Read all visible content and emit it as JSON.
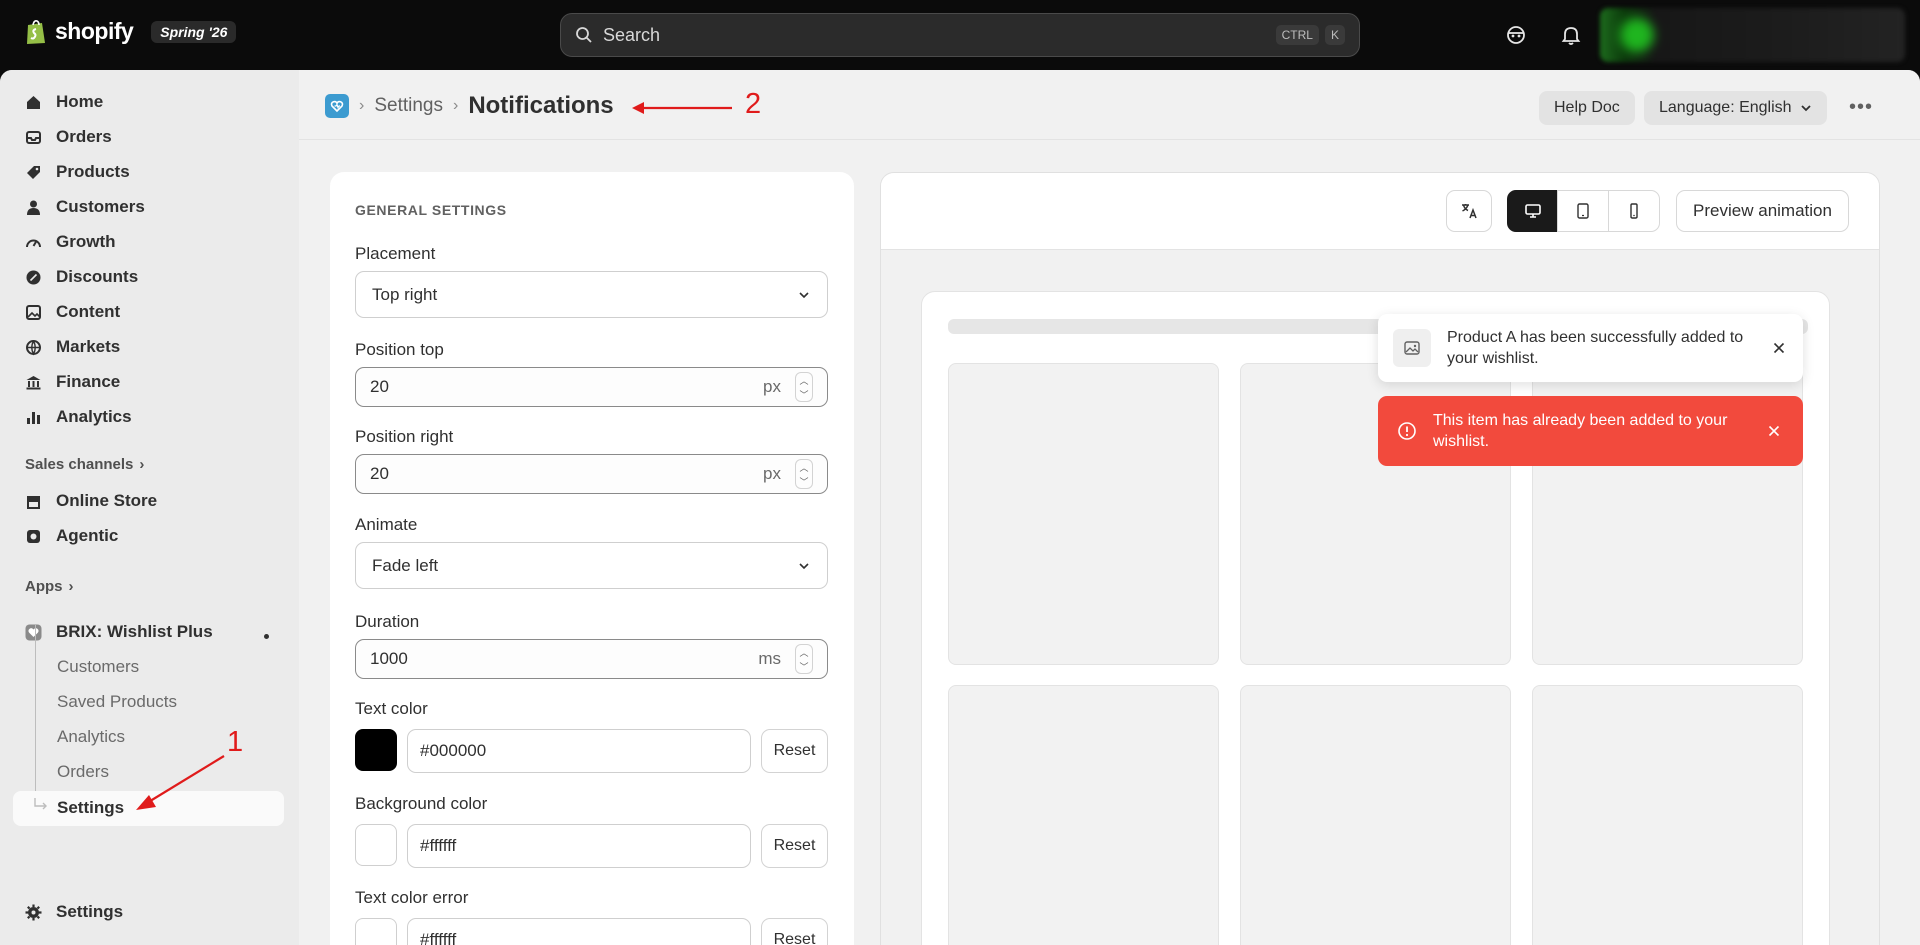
{
  "topbar": {
    "brand": "shopify",
    "edition": "Spring '26",
    "search_placeholder": "Search",
    "shortcut_ctrl": "CTRL",
    "shortcut_key": "K"
  },
  "sidebar": {
    "main_items": [
      {
        "label": "Home",
        "icon": "home-icon"
      },
      {
        "label": "Orders",
        "icon": "inbox-icon"
      },
      {
        "label": "Products",
        "icon": "tag-icon"
      },
      {
        "label": "Customers",
        "icon": "person-icon"
      },
      {
        "label": "Growth",
        "icon": "gauge-icon"
      },
      {
        "label": "Discounts",
        "icon": "discount-icon"
      },
      {
        "label": "Content",
        "icon": "image-icon"
      },
      {
        "label": "Markets",
        "icon": "globe-icon"
      },
      {
        "label": "Finance",
        "icon": "bank-icon"
      },
      {
        "label": "Analytics",
        "icon": "bar-chart-icon"
      }
    ],
    "sales_channels_label": "Sales channels",
    "channels": [
      {
        "label": "Online Store",
        "icon": "store-icon"
      },
      {
        "label": "Agentic",
        "icon": "agent-icon"
      }
    ],
    "apps_label": "Apps",
    "app": {
      "label": "BRIX: Wishlist Plus",
      "icon": "heart-app-icon"
    },
    "app_subitems": [
      "Customers",
      "Saved Products",
      "Analytics",
      "Orders",
      "Settings"
    ],
    "bottom_settings": "Settings"
  },
  "header": {
    "breadcrumb_parent": "Settings",
    "title": "Notifications",
    "help_button": "Help Doc",
    "language_button": "Language: English"
  },
  "general_settings": {
    "section_title": "GENERAL SETTINGS",
    "placement": {
      "label": "Placement",
      "value": "Top right"
    },
    "position_top": {
      "label": "Position top",
      "value": "20",
      "unit": "px"
    },
    "position_right": {
      "label": "Position right",
      "value": "20",
      "unit": "px"
    },
    "animate": {
      "label": "Animate",
      "value": "Fade left"
    },
    "duration": {
      "label": "Duration",
      "value": "1000",
      "unit": "ms"
    },
    "text_color": {
      "label": "Text color",
      "value": "#000000",
      "swatch": "#000000"
    },
    "background_color": {
      "label": "Background color",
      "value": "#ffffff",
      "swatch": "#ffffff"
    },
    "text_color_error": {
      "label": "Text color error",
      "value": "#ffffff",
      "swatch": "#ffffff"
    },
    "reset_label": "Reset"
  },
  "preview": {
    "animation_button": "Preview animation",
    "devices": [
      "desktop",
      "tablet",
      "mobile"
    ],
    "active_device": "desktop",
    "toast_success": "Product A has been successfully added to your wishlist.",
    "toast_error": "This item has already been added to your wishlist.",
    "error_color": "#f24a3d"
  },
  "annotations": {
    "marker_1": "1",
    "marker_2": "2"
  }
}
